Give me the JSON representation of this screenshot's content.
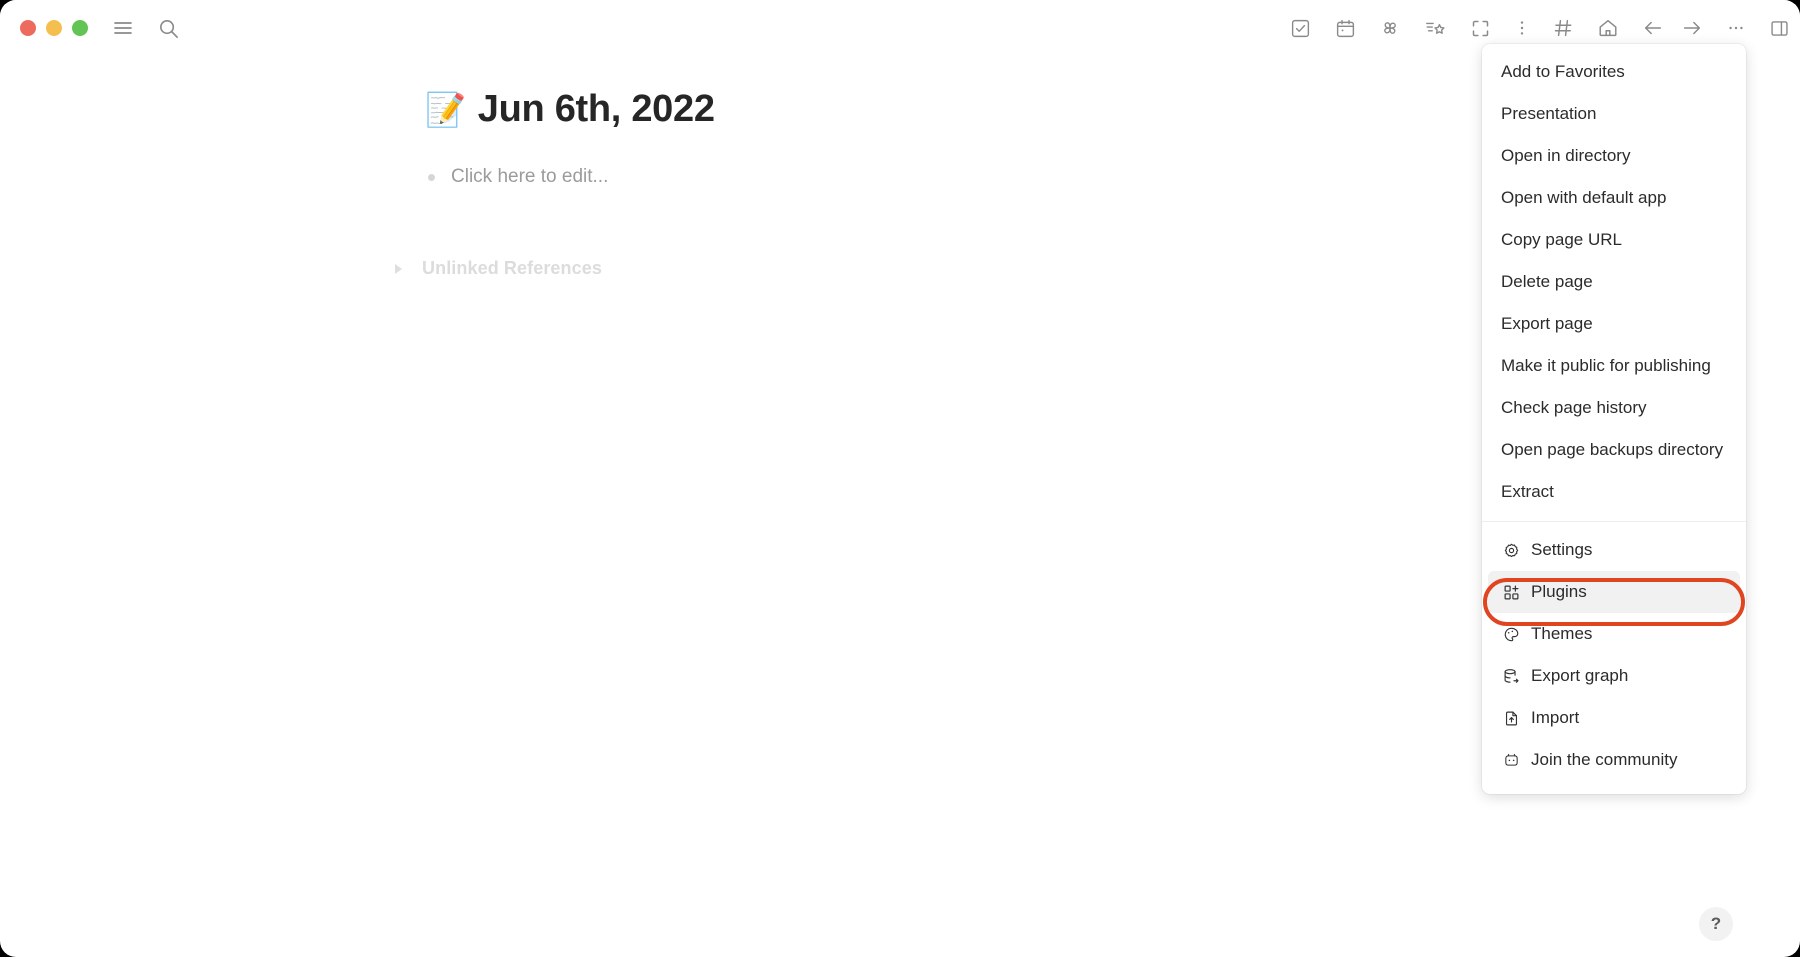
{
  "window": {
    "traffic_lights": [
      {
        "name": "close",
        "color": "#ED6A5E"
      },
      {
        "name": "minimize",
        "color": "#F4BF4F"
      },
      {
        "name": "maximize",
        "color": "#61C454"
      }
    ]
  },
  "toolbar": {
    "left_icons": [
      {
        "name": "hamburger-menu-icon",
        "label": "Toggle left sidebar"
      },
      {
        "name": "search-icon",
        "label": "Search"
      }
    ],
    "right_icons": [
      {
        "name": "checkbox-task-icon",
        "label": "Tasks"
      },
      {
        "name": "calendar-icon",
        "label": "Journals"
      },
      {
        "name": "pinwheel-icon",
        "label": "What's new"
      },
      {
        "name": "shooting-star-icon",
        "label": "Flashcards"
      },
      {
        "name": "fullscreen-icon",
        "label": "Zen mode"
      },
      {
        "name": "dots-vertical-icon",
        "label": "More options"
      },
      {
        "name": "hash-icon",
        "label": "Tags"
      },
      {
        "name": "home-icon",
        "label": "Home"
      },
      {
        "name": "arrow-left-icon",
        "label": "Back"
      },
      {
        "name": "arrow-right-icon",
        "label": "Forward"
      },
      {
        "name": "dots-horizontal-icon",
        "label": "More"
      },
      {
        "name": "right-sidebar-icon",
        "label": "Toggle right sidebar"
      }
    ]
  },
  "page": {
    "title_emoji": "📝",
    "title": "Jun 6th, 2022",
    "block_placeholder": "Click here to edit...",
    "unlinked_references_label": "Unlinked References"
  },
  "dropdown": {
    "items": [
      {
        "label": "Add to Favorites",
        "icon": null
      },
      {
        "label": "Presentation",
        "icon": null
      },
      {
        "label": "Open in directory",
        "icon": null
      },
      {
        "label": "Open with default app",
        "icon": null
      },
      {
        "label": "Copy page URL",
        "icon": null
      },
      {
        "label": "Delete page",
        "icon": null
      },
      {
        "label": "Export page",
        "icon": null
      },
      {
        "label": "Make it public for publishing",
        "icon": null
      },
      {
        "label": "Check page history",
        "icon": null
      },
      {
        "label": "Open page backups directory",
        "icon": null
      },
      {
        "label": "Extract",
        "icon": null
      }
    ],
    "items_with_icons": [
      {
        "label": "Settings",
        "icon": "gear-icon"
      },
      {
        "label": "Plugins",
        "icon": "plugins-grid-icon",
        "highlighted": true
      },
      {
        "label": "Themes",
        "icon": "palette-icon"
      },
      {
        "label": "Export graph",
        "icon": "database-export-icon"
      },
      {
        "label": "Import",
        "icon": "file-import-icon"
      },
      {
        "label": "Join the community",
        "icon": "discord-icon"
      }
    ],
    "highlight_color": "#DE4520"
  },
  "help": {
    "label": "?"
  }
}
